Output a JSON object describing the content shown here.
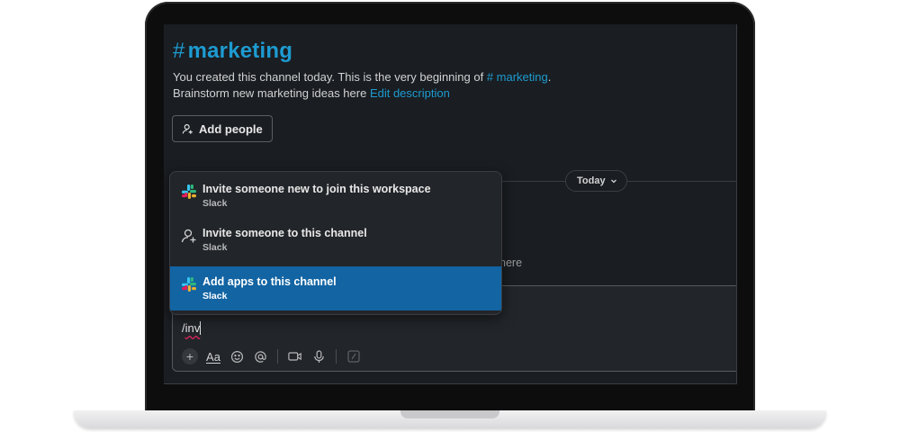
{
  "channel": {
    "hash": "#",
    "name": "marketing",
    "intro_prefix": "You created this channel today. This is the very beginning of ",
    "intro_link": "# marketing",
    "intro_suffix": ".",
    "description": "Brainstorm new marketing ideas here ",
    "edit_description": "Edit description"
  },
  "add_people": {
    "label": "Add people",
    "icon": "add-person-icon"
  },
  "divider": {
    "label": "Today",
    "icon": "chevron-down-icon"
  },
  "behind_text": "here",
  "autocomplete": {
    "items": [
      {
        "title": "Invite someone new to join this workspace",
        "subtitle": "Slack",
        "icon": "slack-logo-icon",
        "selected": false
      },
      {
        "title": "Invite someone to this channel",
        "subtitle": "Slack",
        "icon": "add-user-icon",
        "selected": false
      },
      {
        "title": "Add apps to this channel",
        "subtitle": "Slack",
        "icon": "slack-logo-icon",
        "selected": true
      }
    ]
  },
  "composer": {
    "slash": "/",
    "typed": "inv",
    "toolbar": {
      "plus": "+",
      "format": "Aa",
      "icons": [
        "plus-icon",
        "format-icon",
        "emoji-icon",
        "mention-icon",
        "video-icon",
        "microphone-icon",
        "shortcut-icon"
      ]
    }
  },
  "colors": {
    "background": "#1a1d21",
    "accent_link": "#1d9bd1",
    "selected": "#1264a3"
  }
}
